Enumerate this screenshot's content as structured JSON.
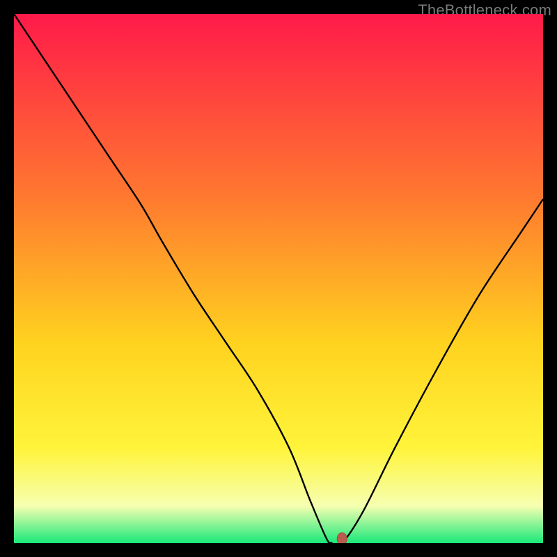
{
  "watermark": "TheBottleneck.com",
  "colors": {
    "bg": "#000000",
    "curve": "#000000",
    "marker_fill": "#bb5b4e",
    "marker_stroke": "#a04d42",
    "grad_top": "#ff1a49",
    "grad_mid1": "#ff7a2f",
    "grad_mid2": "#ffd21f",
    "grad_mid3": "#fff43a",
    "grad_low": "#f6ffb0",
    "grad_bot": "#19e87a"
  },
  "chart_data": {
    "type": "line",
    "title": "",
    "xlabel": "",
    "ylabel": "",
    "xlim": [
      0,
      100
    ],
    "ylim": [
      0,
      100
    ],
    "x": [
      0,
      6,
      12,
      18,
      24,
      28,
      34,
      40,
      46,
      52,
      56,
      59,
      60,
      62,
      66,
      72,
      80,
      88,
      96,
      100
    ],
    "values": [
      100,
      91,
      82,
      73,
      64,
      57,
      47,
      38,
      29,
      18,
      8,
      1,
      0,
      0,
      6,
      18,
      33,
      47,
      59,
      65
    ],
    "marker": {
      "x": 62,
      "y": 0
    },
    "annotations": []
  }
}
